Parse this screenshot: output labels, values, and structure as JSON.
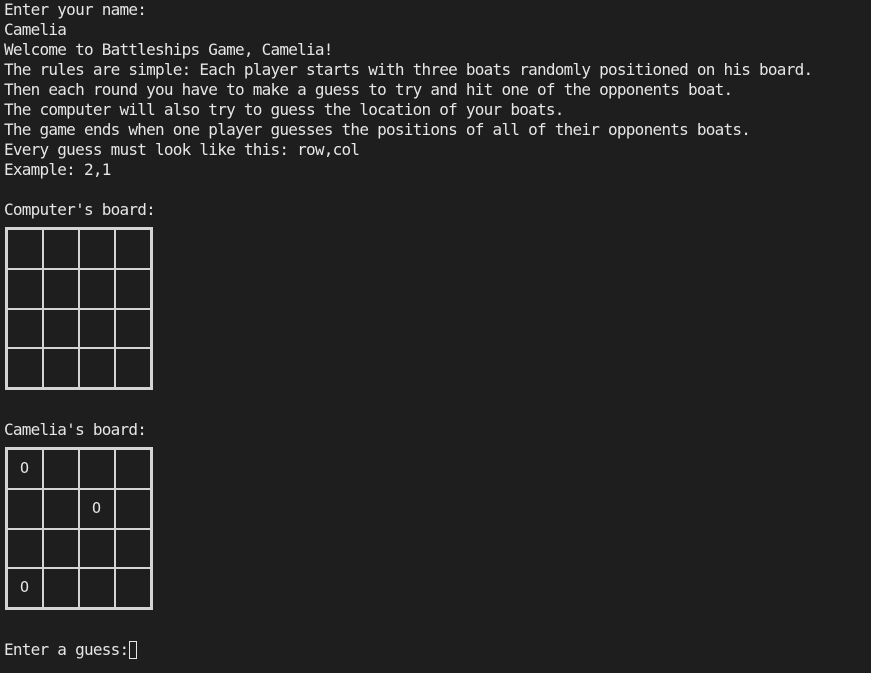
{
  "terminal": {
    "prompt_name": "Enter your name:",
    "entered_name": "Camelia",
    "welcome": "Welcome to Battleships Game, Camelia!",
    "rules": [
      "The rules are simple: Each player starts with three boats randomly positioned on his board.",
      "Then each round you have to make a guess to try and hit one of the opponents boat.",
      "The computer will also try to guess the location of your boats.",
      "The game ends when one player guesses the positions of all of their opponents boats.",
      "Every guess must look like this: row,col",
      "Example: 2,1"
    ],
    "computer_board_label": "Computer's board:",
    "player_board_label": "Camelia's board:",
    "guess_prompt": "Enter a guess:"
  },
  "computer_board": {
    "rows": [
      [
        "",
        "",
        "",
        ""
      ],
      [
        "",
        "",
        "",
        ""
      ],
      [
        "",
        "",
        "",
        ""
      ],
      [
        "",
        "",
        "",
        ""
      ]
    ]
  },
  "player_board": {
    "rows": [
      [
        "O",
        "",
        "",
        ""
      ],
      [
        "",
        "",
        "O",
        ""
      ],
      [
        "",
        "",
        "",
        ""
      ],
      [
        "O",
        "",
        "",
        ""
      ]
    ]
  }
}
